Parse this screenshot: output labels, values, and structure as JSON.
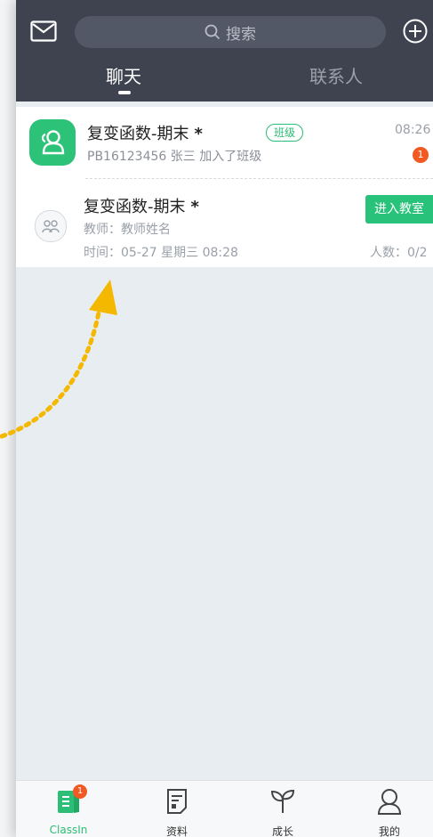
{
  "header": {
    "search_placeholder": "搜索",
    "tabs": [
      {
        "label": "聊天"
      },
      {
        "label": "联系人"
      }
    ]
  },
  "conversations": [
    {
      "title": "复变函数-期末",
      "star": "*",
      "tag": "班级",
      "subtitle": "PB16123456 张三 加入了班级",
      "time": "08:26",
      "unread": "1"
    },
    {
      "title": "复变函数-期末",
      "star": "*",
      "teacher": "教师：教师姓名",
      "time": "时间：05-27 星期三 08:28",
      "action": "进入教室",
      "count": "人数：0/2"
    }
  ],
  "tabbar": {
    "items": [
      {
        "label": "ClassIn",
        "icon": "classin-icon",
        "badge": "1"
      },
      {
        "label": "资料",
        "icon": "document-icon"
      },
      {
        "label": "成长",
        "icon": "sprout-icon"
      },
      {
        "label": "我的",
        "icon": "user-icon"
      }
    ]
  },
  "colors": {
    "header": "#3f4350",
    "accent": "#2cbd76",
    "badge": "#f15a22",
    "arrow": "#f5b800"
  }
}
